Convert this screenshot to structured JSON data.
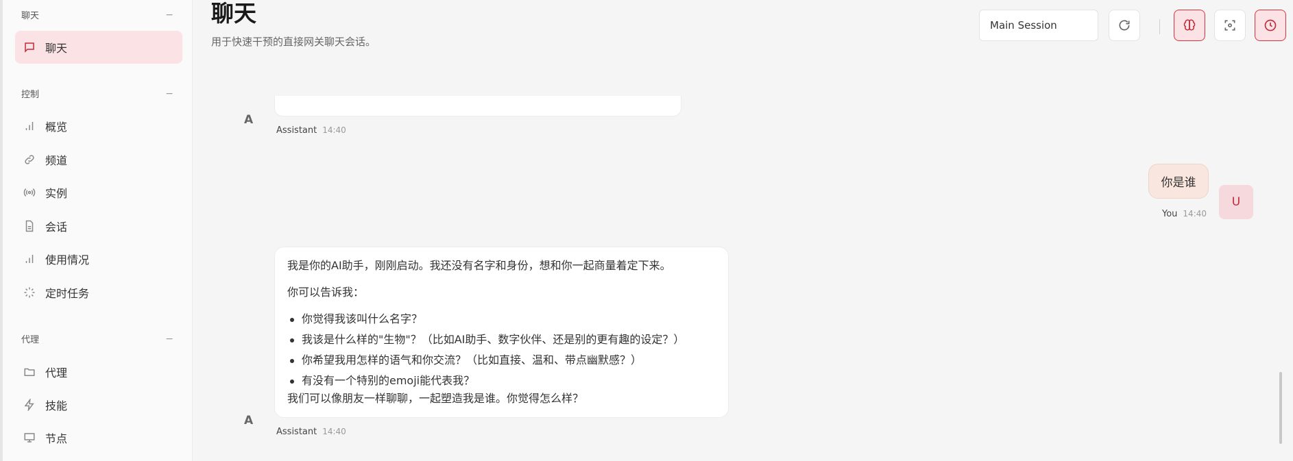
{
  "sidebar": {
    "groups": [
      {
        "label": "聊天",
        "collapse": "−"
      },
      {
        "label": "控制",
        "collapse": "−"
      },
      {
        "label": "代理",
        "collapse": "−"
      }
    ],
    "items": [
      {
        "label": "聊天",
        "icon": "chat-bubble-icon"
      },
      {
        "label": "概览",
        "icon": "bar-chart-icon"
      },
      {
        "label": "频道",
        "icon": "link-icon"
      },
      {
        "label": "实例",
        "icon": "broadcast-icon"
      },
      {
        "label": "会话",
        "icon": "document-icon"
      },
      {
        "label": "使用情况",
        "icon": "bar-chart-icon"
      },
      {
        "label": "定时任务",
        "icon": "spinner-icon"
      },
      {
        "label": "代理",
        "icon": "folder-icon"
      },
      {
        "label": "技能",
        "icon": "lightning-icon"
      },
      {
        "label": "节点",
        "icon": "monitor-icon"
      }
    ]
  },
  "header": {
    "title": "聊天",
    "subtitle": "用于快速干预的直接网关聊天会话。",
    "session_value": "Main Session"
  },
  "messages": {
    "assistant_initial": "A",
    "assistant_name": "Assistant",
    "first_time": "14:40",
    "user_text": "你是谁",
    "user_initial": "U",
    "user_name": "You",
    "user_time": "14:40",
    "reply": {
      "p1": "我是你的AI助手，刚刚启动。我还没有名字和身份，想和你一起商量着定下来。",
      "p2": "你可以告诉我：",
      "bullets": [
        "你觉得我该叫什么名字？",
        "我该是什么样的\"生物\"？（比如AI助手、数字伙伴、还是别的更有趣的设定？）",
        "你希望我用怎样的语气和你交流？（比如直接、温和、带点幽默感？）",
        "有没有一个特别的emoji能代表我？"
      ],
      "closing": "我们可以像朋友一样聊聊，一起塑造我是谁。你觉得怎么样？"
    },
    "reply_time": "14:40"
  },
  "colors": {
    "accent": "#c22a3a",
    "accent_bg": "#fbe3e5"
  }
}
